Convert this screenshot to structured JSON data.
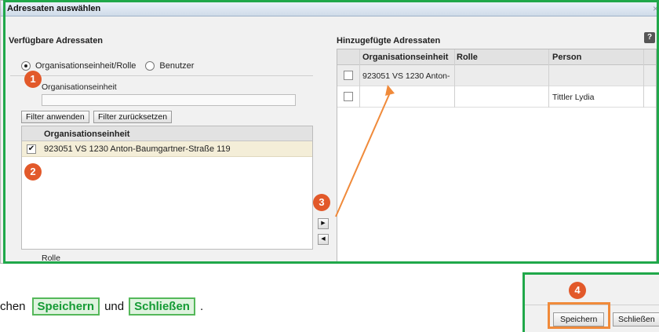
{
  "dialog": {
    "title": "Adressaten auswählen",
    "close_glyph": "×"
  },
  "left": {
    "heading": "Verfügbare Adressaten",
    "radio_options": [
      {
        "label": "Organisationseinheit/Rolle",
        "checked": true
      },
      {
        "label": "Benutzer",
        "checked": false
      }
    ],
    "field_label": "Organisationseinheit",
    "field_value": "",
    "filter_apply": "Filter anwenden",
    "filter_reset": "Filter zurücksetzen",
    "list_header": "Organisationseinheit",
    "list_rows": [
      {
        "label": "923051 VS 1230 Anton-Baumgartner-Straße 119",
        "checked": true
      }
    ],
    "rolle_label": "Rolle"
  },
  "right": {
    "heading": "Hinzugefügte Adressaten",
    "help_glyph": "?",
    "columns": [
      "Organisationseinheit",
      "Rolle",
      "Person"
    ],
    "rows": [
      {
        "org": "923051 VS 1230 Anton-",
        "rolle": "",
        "person": ""
      },
      {
        "org": "",
        "rolle": "",
        "person": "Tittler Lydia"
      }
    ]
  },
  "transfer": {
    "add_glyph": "▶",
    "remove_glyph": "◀"
  },
  "badges": [
    "1",
    "2",
    "3",
    "4"
  ],
  "footer": {
    "save": "Speichern",
    "close": "Schließen"
  },
  "instruction": {
    "prefix": "chen",
    "save": "Speichern",
    "middle": "und",
    "close": "Schließen",
    "suffix": "."
  },
  "colors": {
    "frame_green": "#20a84a",
    "badge_orange": "#e2592a",
    "highlight_orange": "#f08a3a"
  }
}
